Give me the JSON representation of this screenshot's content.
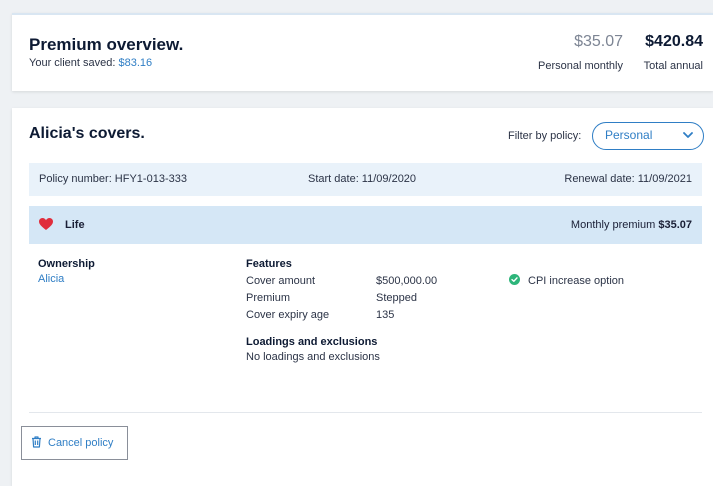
{
  "overview": {
    "title": "Premium overview.",
    "saved_prefix": "Your client saved: ",
    "saved_amount": "$83.16",
    "monthly_value": "$35.07",
    "monthly_label": "Personal monthly",
    "annual_value": "$420.84",
    "annual_label": "Total annual"
  },
  "covers": {
    "title": "Alicia's covers.",
    "filter_label": "Filter by policy:",
    "filter_selected": "Personal",
    "policy": {
      "number": "Policy number: HFY1-013-333",
      "start": "Start date: 11/09/2020",
      "renewal": "Renewal date: 11/09/2021"
    },
    "life": {
      "icon": "heart-icon",
      "name": "Life",
      "premium_label": "Monthly premium ",
      "premium_value": "$35.07"
    },
    "ownership": {
      "heading": "Ownership",
      "owner": "Alicia"
    },
    "features": {
      "heading": "Features",
      "rows": [
        {
          "label": "Cover amount",
          "value": "$500,000.00"
        },
        {
          "label": "Premium",
          "value": "Stepped"
        },
        {
          "label": "Cover expiry age",
          "value": "135"
        }
      ]
    },
    "loadings": {
      "heading": "Loadings and exclusions",
      "text": "No loadings and exclusions"
    },
    "cpi": {
      "icon": "check-circle-icon",
      "label": "CPI increase option"
    },
    "cancel": {
      "icon": "trash-icon",
      "label": "Cancel policy"
    }
  },
  "colors": {
    "accent": "#2f7ec5",
    "heart": "#e02d3c",
    "check": "#2db57a",
    "policy_bar": "#e9f2fa",
    "life_bar": "#d5e7f6"
  }
}
